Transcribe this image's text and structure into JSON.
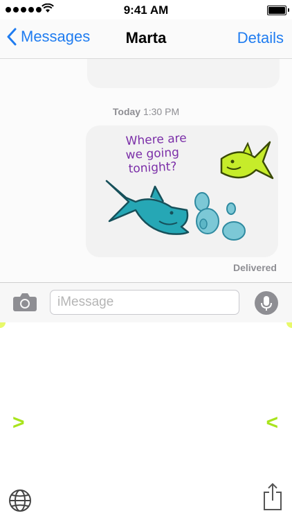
{
  "status_bar": {
    "time": "9:41 AM"
  },
  "nav": {
    "back_label": "Messages",
    "title": "Marta",
    "details_label": "Details"
  },
  "conversation": {
    "timestamp_day": "Today",
    "timestamp_time": "1:30 PM",
    "drawing_text": [
      "Where are",
      "we going",
      "tonight?"
    ],
    "status": "Delivered"
  },
  "input": {
    "placeholder": "iMessage"
  },
  "keyboard": {
    "left_arrow": ">",
    "right_arrow": "<"
  },
  "colors": {
    "accent": "#1f7cf0",
    "shark": "#26a7b5",
    "fish": "#c6ec2a",
    "bubbles": "#7cc8d6",
    "handwriting": "#7b2fa8"
  }
}
